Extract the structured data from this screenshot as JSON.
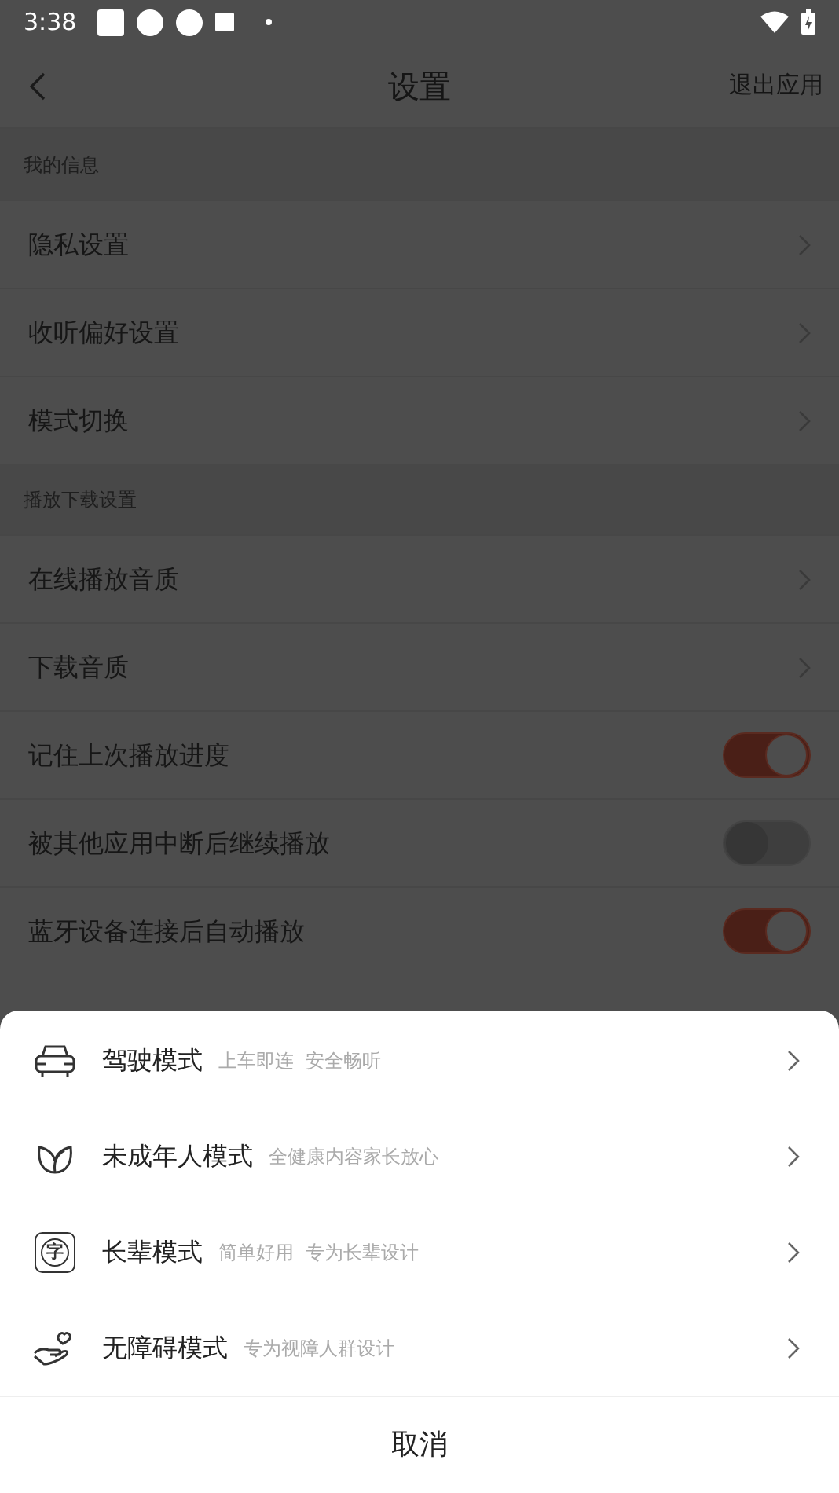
{
  "status_bar": {
    "time": "3:38"
  },
  "header": {
    "title": "设置",
    "action": "退出应用"
  },
  "sections": [
    {
      "title": "我的信息",
      "rows": [
        {
          "kind": "link",
          "label": "隐私设置"
        },
        {
          "kind": "link",
          "label": "收听偏好设置"
        },
        {
          "kind": "link",
          "label": "模式切换"
        }
      ]
    },
    {
      "title": "播放下载设置",
      "rows": [
        {
          "kind": "link",
          "label": "在线播放音质"
        },
        {
          "kind": "link",
          "label": "下载音质"
        },
        {
          "kind": "toggle",
          "label": "记住上次播放进度",
          "on": true
        },
        {
          "kind": "toggle",
          "label": "被其他应用中断后继续播放",
          "on": false
        },
        {
          "kind": "toggle",
          "label": "蓝牙设备连接后自动播放",
          "on": true
        }
      ]
    }
  ],
  "sheet": {
    "options": [
      {
        "kind": "car",
        "label": "驾驶模式",
        "hint": "上车即连  安全畅听"
      },
      {
        "kind": "leaf",
        "label": "未成年人模式",
        "hint": "全健康内容家长放心"
      },
      {
        "kind": "elder",
        "label": "长辈模式",
        "hint": "简单好用  专为长辈设计",
        "icon_label": "字"
      },
      {
        "kind": "hand",
        "label": "无障碍模式",
        "hint": "专为视障人群设计"
      }
    ],
    "cancel": "取消"
  }
}
